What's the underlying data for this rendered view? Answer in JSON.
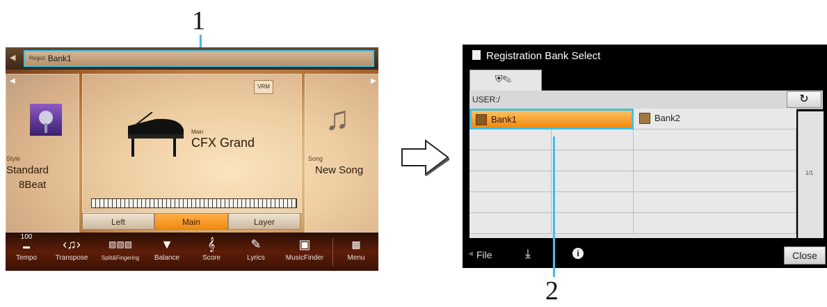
{
  "callouts": {
    "one": "1",
    "two": "2"
  },
  "left_screen": {
    "regist": {
      "small_label": "Regist",
      "bank": "Bank1"
    },
    "style": {
      "label": "Style",
      "name_line1": "Standard",
      "name_line2": "8Beat"
    },
    "main_voice": {
      "badge": "VRM",
      "label": "Main",
      "name": "CFX Grand"
    },
    "song": {
      "label": "Song",
      "name": "New Song"
    },
    "parts": [
      "Left",
      "Main",
      "Layer"
    ],
    "nav": {
      "tempo_value": "100",
      "items": [
        "Tempo",
        "Transpose",
        "Split&Fingering",
        "Balance",
        "Score",
        "Lyrics",
        "MusicFinder",
        "Menu"
      ]
    }
  },
  "right_screen": {
    "title": "Registration Bank Select",
    "path": "USER:/",
    "files": [
      "Bank1",
      "Bank2"
    ],
    "page": "1/1",
    "footer": {
      "file": "File",
      "close": "Close"
    }
  },
  "colors": {
    "highlight": "#3ec1e6",
    "selected_orange": "#f08a10",
    "nav_bar": "#4a1606"
  }
}
